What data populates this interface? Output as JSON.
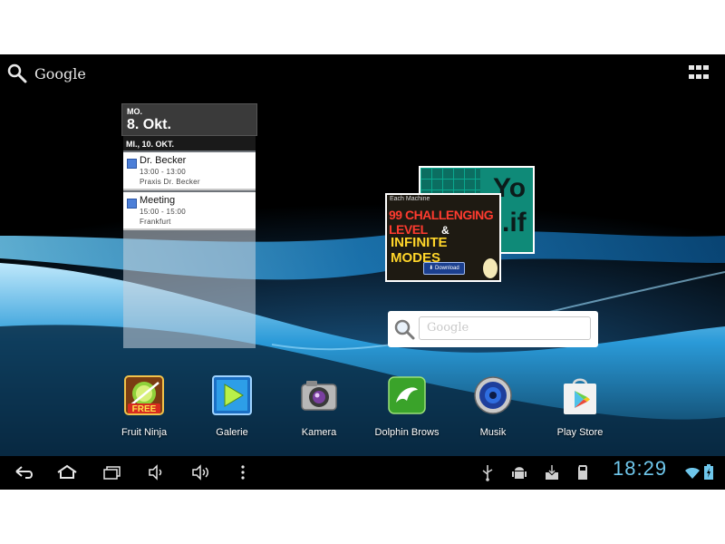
{
  "top_bar": {
    "search_label": "Google",
    "icons": [
      "search-icon",
      "all-apps-icon"
    ]
  },
  "calendar": {
    "header_day": "MO.",
    "header_date": "8. Okt.",
    "subheader": "MI., 10. OKT.",
    "events": [
      {
        "title": "Dr. Becker",
        "time": "13:00 - 13:00",
        "location": "Praxis Dr. Becker"
      },
      {
        "title": "Meeting",
        "time": "15:00 - 15:00",
        "location": "Frankfurt"
      }
    ]
  },
  "promo": {
    "back_text_1": "Yo",
    "back_text_2": ".if",
    "front_top": "Each Machine",
    "front_line1": "99 CHALLENGING LEVEL",
    "front_amp": "&",
    "front_line2": "INFINITE MODES",
    "front_button": "⬇ Download"
  },
  "search_widget": {
    "placeholder": "Google"
  },
  "apps": [
    {
      "label": "Fruit Ninja",
      "icon": "fruit-ninja-icon"
    },
    {
      "label": "Galerie",
      "icon": "gallery-icon"
    },
    {
      "label": "Kamera",
      "icon": "camera-icon"
    },
    {
      "label": "Dolphin Brows",
      "icon": "dolphin-browser-icon"
    },
    {
      "label": "Musik",
      "icon": "music-icon"
    },
    {
      "label": "Play Store",
      "icon": "play-store-icon"
    }
  ],
  "fruit_ninja_badge": "FREE",
  "status": {
    "time": "18:29",
    "icons": [
      "usb-icon",
      "android-debug-icon",
      "download-icon",
      "sd-card-icon",
      "wifi-icon",
      "battery-icon"
    ]
  },
  "nav": {
    "icons": [
      "back-icon",
      "home-icon",
      "recent-apps-icon",
      "volume-down-icon",
      "volume-up-icon",
      "menu-icon"
    ]
  },
  "colors": {
    "clock": "#6fc7ec",
    "wallpaper_accent": "#2a9ad8"
  }
}
